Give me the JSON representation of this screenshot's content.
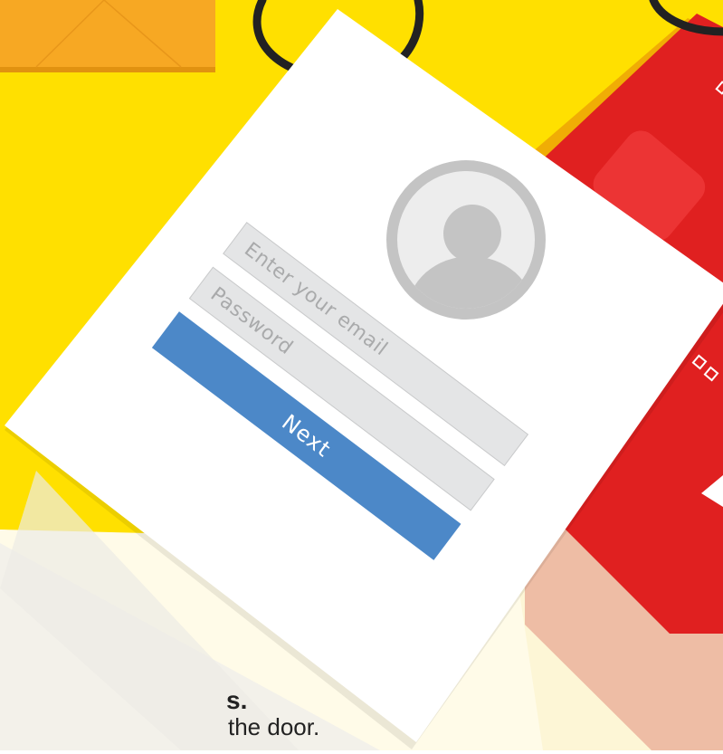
{
  "login": {
    "email_placeholder": "Enter your email",
    "password_placeholder": "Password",
    "next_label": "Next"
  },
  "caption": {
    "title": "s.",
    "subtitle": "the door."
  },
  "colors": {
    "background": "#ffe000",
    "red_tag": "#e02020",
    "orange_envelope": "#f7a823",
    "button": "#4c88c8",
    "field": "#e4e5e6",
    "avatar": "#c4c4c4"
  },
  "icons": [
    "envelope-icon",
    "avatar-icon",
    "hook-icon"
  ]
}
